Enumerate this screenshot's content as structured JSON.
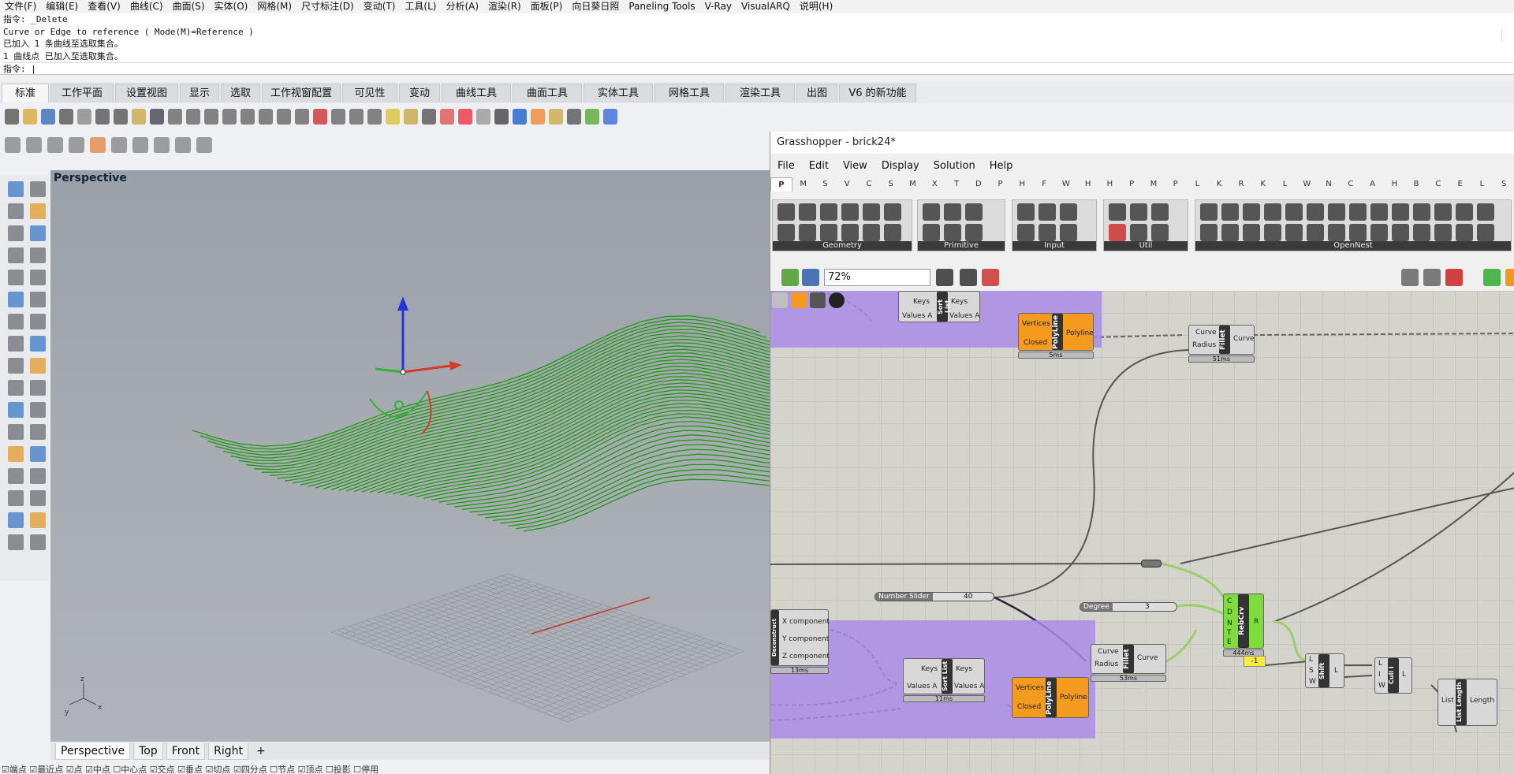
{
  "menu": [
    "文件(F)",
    "编辑(E)",
    "查看(V)",
    "曲线(C)",
    "曲面(S)",
    "实体(O)",
    "网格(M)",
    "尺寸标注(D)",
    "变动(T)",
    "工具(L)",
    "分析(A)",
    "渲染(R)",
    "面板(P)",
    "向日葵日照",
    "Paneling Tools",
    "V-Ray",
    "VisualARQ",
    "说明(H)"
  ],
  "command_history": [
    "指令: _Delete",
    "Curve or Edge to reference ( Mode(M)=Reference )",
    "已加入 1 条曲线至选取集合。",
    "1 曲线点 已加入至选取集合。"
  ],
  "command_prompt": "指令: |",
  "toolbar_tabs": [
    "标准",
    "工作平面",
    "设置视图",
    "显示",
    "选取",
    "工作视窗配置",
    "可见性",
    "变动",
    "曲线工具",
    "曲面工具",
    "实体工具",
    "网格工具",
    "渲染工具",
    "出图",
    "V6 的新功能"
  ],
  "active_toolbar_tab": "标准",
  "viewport": {
    "title": "Perspective",
    "axis_x": "x",
    "axis_y": "y",
    "axis_z": "z"
  },
  "viewport_tabs": [
    "Perspective",
    "Top",
    "Front",
    "Right"
  ],
  "status_snaps": "☑端点 ☑最近点 ☑点 ☑中点 ☐中心点 ☑交点 ☑垂点 ☑切点 ☑四分点 ☐节点 ☑顶点 ☐投影 ☐停用",
  "grasshopper": {
    "title": "Grasshopper - brick24*",
    "menu": [
      "File",
      "Edit",
      "View",
      "Display",
      "Solution",
      "Help"
    ],
    "tabs": [
      "P",
      "M",
      "S",
      "V",
      "C",
      "S",
      "M",
      "X",
      "T",
      "D",
      "P",
      "H",
      "F",
      "W",
      "H",
      "H",
      "P",
      "M",
      "P",
      "L",
      "K",
      "R",
      "K",
      "L",
      "W",
      "N",
      "C",
      "A",
      "H",
      "B",
      "C",
      "E",
      "L",
      "S"
    ],
    "groups": [
      "Geometry",
      "Primitive",
      "Input",
      "Util",
      "OpenNest"
    ],
    "zoom": "72%",
    "components": {
      "sortlist1": {
        "name": "Sort List",
        "in": [
          "Keys",
          "Values A"
        ],
        "out": [
          "Keys",
          "Values A"
        ]
      },
      "polyline1": {
        "name": "PolyLine",
        "in": [
          "Vertices",
          "Closed"
        ],
        "out": [
          "Polyline"
        ],
        "time": "5ms"
      },
      "fillet1": {
        "name": "Fillet",
        "in": [
          "Curve",
          "Radius"
        ],
        "out": [
          "Curve"
        ],
        "time": "51ms"
      },
      "slider1": {
        "label": "Number Slider",
        "value": "40"
      },
      "slider2": {
        "label": "Degree",
        "value": "3"
      },
      "rebuild": {
        "name": "RebCrv",
        "in": [
          "C",
          "D",
          "N",
          "T",
          "E"
        ],
        "out": [
          "R"
        ],
        "time": "444ms"
      },
      "deconstruct": {
        "name": "Deconstruct",
        "out": [
          "X component",
          "Y component",
          "Z component"
        ],
        "time": "13ms"
      },
      "sortlist2": {
        "name": "Sort List",
        "in": [
          "Keys",
          "Values A"
        ],
        "out": [
          "Keys",
          "Values A"
        ],
        "time": "11ms"
      },
      "polyline2": {
        "name": "PolyLine",
        "in": [
          "Vertices",
          "Closed"
        ],
        "out": [
          "Polyline"
        ]
      },
      "fillet2": {
        "name": "Fillet",
        "in": [
          "Curve",
          "Radius"
        ],
        "out": [
          "Curve"
        ],
        "time": "53ms"
      },
      "shift": {
        "name": "Shift",
        "in": [
          "L",
          "S",
          "W"
        ],
        "out": [
          "L"
        ]
      },
      "cull": {
        "name": "Cull i",
        "in": [
          "L",
          "I",
          "W"
        ],
        "out": [
          "L"
        ]
      },
      "listlength": {
        "name": "List Length",
        "in": [
          "List"
        ],
        "out": [
          "Length"
        ]
      },
      "panel": {
        "value": "-1"
      }
    }
  },
  "colors": {
    "surface_green": "#2e9c10",
    "group_purple": "#a98ce6",
    "component_orange": "#f39a1f",
    "component_green": "#7edc3c"
  }
}
